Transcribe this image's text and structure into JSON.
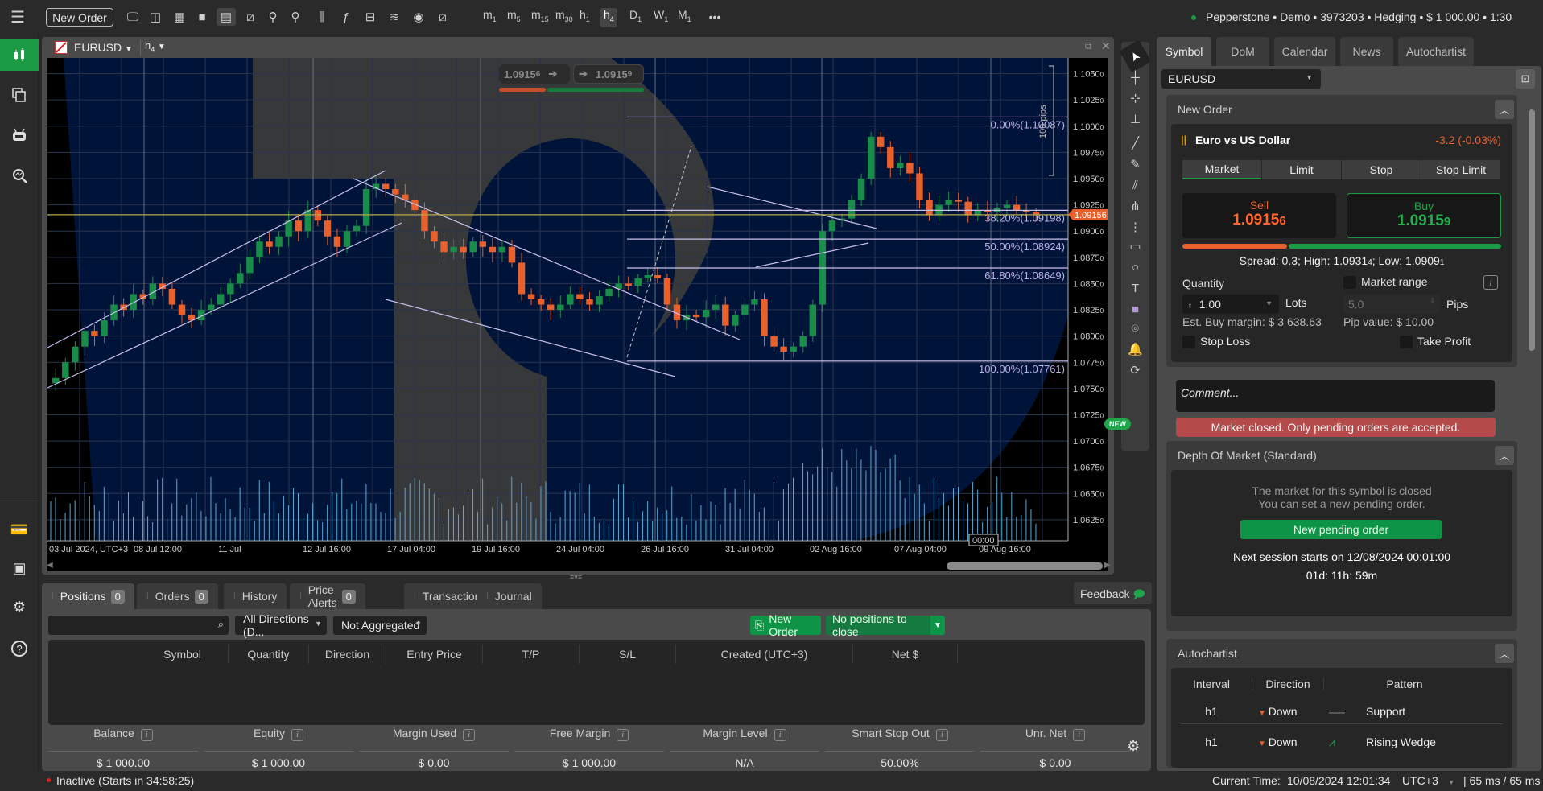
{
  "topbar": {
    "new_order_label": "New Order",
    "icons": [
      "chart-monitor-icon",
      "layout-split-icon",
      "grid-4-icon",
      "single-view-icon",
      "multi-view-icon",
      "chart-add-icon",
      "zoom-out-icon",
      "zoom-in-icon",
      "chart-type-icon",
      "indicators-icon",
      "robot-icon",
      "layers-icon",
      "eye-icon",
      "chart-settings-icon"
    ],
    "timeframes": [
      {
        "letter": "m",
        "sub": "1",
        "active": false
      },
      {
        "letter": "m",
        "sub": "5",
        "active": false
      },
      {
        "letter": "m",
        "sub": "15",
        "active": false
      },
      {
        "letter": "m",
        "sub": "30",
        "active": false
      },
      {
        "letter": "h",
        "sub": "1",
        "active": false
      },
      {
        "letter": "h",
        "sub": "4",
        "active": true
      },
      {
        "letter": "D",
        "sub": "1",
        "active": false
      },
      {
        "letter": "W",
        "sub": "1",
        "active": false
      },
      {
        "letter": "M",
        "sub": "1",
        "active": false
      }
    ],
    "more_label": "•••",
    "account": "Pepperstone • Demo • 3973203 • Hedging • $ 1 000.00 • 1:30",
    "account_status_color": "#1d9a3c"
  },
  "left_sidebar": {
    "items": [
      "trade-chart-icon",
      "copy-icon",
      "algo-robot-icon",
      "analyze-icon"
    ],
    "bottom_items": [
      "atm-icon",
      "wallet-icon",
      "settings-icon",
      "help-icon"
    ]
  },
  "chart": {
    "symbol": "EURUSD",
    "timeframe_letter": "h",
    "timeframe_sub": "4",
    "quick_sell": "1.0915",
    "quick_sell_pip": "6",
    "quick_buy": "1.0915",
    "quick_buy_pip": "9",
    "current_price_label": "1.09156",
    "new_badge": "NEW",
    "pips_label": "100 pips",
    "time_cursor_label": "00:00",
    "colors": {
      "bull": "#1a8c4a",
      "bear": "#e8612c",
      "bg": "#00143a",
      "accent_line": "#b8a84a",
      "fib": "#b9aee6"
    }
  },
  "chart_data": {
    "type": "candlestick",
    "title": "EURUSD h4",
    "ylim": [
      1.0605,
      1.1065
    ],
    "y_ticks": [
      "1.1050",
      "1.1025",
      "1.1000",
      "1.0975",
      "1.0950",
      "1.0925",
      "1.0900",
      "1.0875",
      "1.0850",
      "1.0825",
      "1.0800",
      "1.0775",
      "1.0750",
      "1.0725",
      "1.0700",
      "1.0675",
      "1.0650",
      "1.0625"
    ],
    "x_ticks": [
      "03 Jul 2024, UTC+3",
      "08 Jul 12:00",
      "11 Jul",
      "12 Jul 16:00",
      "17 Jul 04:00",
      "19 Jul 16:00",
      "24 Jul 04:00",
      "26 Jul 16:00",
      "31 Jul 04:00",
      "02 Aug 16:00",
      "07 Aug 04:00",
      "09 Aug 16:00"
    ],
    "current_price": 1.09156,
    "fib_levels": [
      {
        "label": "0.00%(1.10087)",
        "price": 1.10087
      },
      {
        "label": "38.20%(1.09198)",
        "price": 1.09198
      },
      {
        "label": "50.00%(1.08924)",
        "price": 1.08924
      },
      {
        "label": "61.80%(1.08649)",
        "price": 1.08649
      },
      {
        "label": "100.00%(1.07761)",
        "price": 1.07761
      }
    ],
    "price_path": [
      1.076,
      1.0775,
      1.079,
      1.0805,
      1.08,
      1.0815,
      1.083,
      1.0825,
      1.084,
      1.0835,
      1.085,
      1.0845,
      1.083,
      1.082,
      1.0815,
      1.0825,
      1.083,
      1.084,
      1.085,
      1.086,
      1.0875,
      1.089,
      1.0885,
      1.0895,
      1.091,
      1.09,
      1.092,
      1.091,
      1.0895,
      1.0885,
      1.09,
      1.0905,
      1.094,
      1.0945,
      1.094,
      1.0935,
      1.093,
      1.092,
      1.09,
      1.089,
      1.088,
      1.0885,
      1.088,
      1.089,
      1.0885,
      1.088,
      1.0885,
      1.087,
      1.084,
      1.0835,
      1.083,
      1.0825,
      1.083,
      1.084,
      1.0835,
      1.083,
      1.0838,
      1.0845,
      1.085,
      1.0848,
      1.0855,
      1.0858,
      1.0855,
      1.083,
      1.0815,
      1.082,
      1.0818,
      1.0825,
      1.083,
      1.081,
      1.082,
      1.083,
      1.0835,
      1.08,
      1.079,
      1.0785,
      1.079,
      1.08,
      1.083,
      1.09,
      1.091,
      1.0912,
      1.093,
      1.095,
      1.099,
      1.098,
      1.096,
      1.0965,
      1.0955,
      1.093,
      1.0915,
      1.0925,
      1.093,
      1.0928,
      1.0915,
      1.092,
      1.0918,
      1.0922,
      1.0925,
      1.092,
      1.0918,
      1.0916
    ]
  },
  "right_tools": [
    "cursor-icon",
    "crosshair-icon",
    "crosshair-snap-icon",
    "measure-icon",
    "trendline-icon",
    "pen-icon",
    "fibonacci-icon",
    "pitchfork-icon",
    "fib-grid-icon",
    "rectangle-icon",
    "ellipse-icon",
    "text-icon",
    "color-swatch-icon",
    "camera-icon",
    "alert-bell-icon",
    "replay-icon"
  ],
  "right_panel": {
    "tabs": [
      {
        "label": "Symbol",
        "active": true
      },
      {
        "label": "DoM",
        "active": false
      },
      {
        "label": "Calendar",
        "active": false
      },
      {
        "label": "News",
        "active": false
      },
      {
        "label": "Autochartist",
        "active": false
      }
    ],
    "symbol_select": "EURUSD",
    "new_order": {
      "title": "New Order",
      "symbol_name": "Euro vs US Dollar",
      "change": "-3.2 (-0.03%)",
      "order_types": [
        {
          "label": "Market",
          "active": true
        },
        {
          "label": "Limit",
          "active": false
        },
        {
          "label": "Stop",
          "active": false
        },
        {
          "label": "Stop Limit",
          "active": false
        }
      ],
      "sell_label": "Sell",
      "sell_price": "1.0915",
      "sell_pip": "6",
      "buy_label": "Buy",
      "buy_price": "1.0915",
      "buy_pip": "9",
      "sell_share": 0.33,
      "spread_text": "Spread: 0.3; High: 1.0931",
      "high_pip": "4",
      "low_text": "; Low: 1.0909",
      "low_pip": "1",
      "quantity_label": "Quantity",
      "quantity_value": "1.00",
      "lots_label": "Lots",
      "market_range_label": "Market range",
      "pips_value": "5.0",
      "pips_label": "Pips",
      "est_margin": "Est. Buy margin: $ 3 638.63",
      "pip_value": "Pip value: $ 10.00",
      "stop_loss_label": "Stop Loss",
      "take_profit_label": "Take Profit",
      "comment_placeholder": "Comment...",
      "market_closed": "Market closed. Only pending orders are accepted."
    },
    "dom": {
      "title": "Depth Of Market (Standard)",
      "msg1": "The market for this symbol is closed",
      "msg2": "You can set a new pending order.",
      "button": "New pending order",
      "next_session": "Next session starts on 12/08/2024 00:01:00",
      "countdown": "01d: 11h: 59m"
    },
    "autochartist": {
      "title": "Autochartist",
      "headers": [
        "Interval",
        "Direction",
        "Pattern"
      ],
      "rows": [
        {
          "interval": "h1",
          "direction": "Down",
          "pattern": "Support",
          "icon": "support-pattern-icon"
        },
        {
          "interval": "h1",
          "direction": "Down",
          "pattern": "Rising Wedge",
          "icon": "rising-wedge-pattern-icon"
        }
      ]
    }
  },
  "bottom_panel": {
    "tabs": [
      {
        "label": "Positions",
        "badge": "0",
        "active": true
      },
      {
        "label": "Orders",
        "badge": "0",
        "active": false
      },
      {
        "label": "History",
        "badge": null,
        "active": false
      },
      {
        "label": "Price Alerts",
        "badge": "0",
        "active": false
      },
      {
        "label": "Transactions",
        "badge": null,
        "active": false
      },
      {
        "label": "Journal",
        "badge": null,
        "active": false
      }
    ],
    "feedback_label": "Feedback",
    "search_placeholder": "",
    "direction_filter": "All Directions (D...",
    "aggregation_filter": "Not Aggregated",
    "new_order_label": "New Order",
    "close_label": "No positions to close",
    "columns": [
      "Symbol",
      "Quantity",
      "Direction",
      "Entry Price",
      "T/P",
      "S/L",
      "Created (UTC+3)",
      "Net $"
    ],
    "summary": [
      {
        "label": "Balance",
        "value": "$ 1 000.00"
      },
      {
        "label": "Equity",
        "value": "$ 1 000.00"
      },
      {
        "label": "Margin Used",
        "value": "$ 0.00"
      },
      {
        "label": "Free Margin",
        "value": "$ 1 000.00"
      },
      {
        "label": "Margin Level",
        "value": "N/A"
      },
      {
        "label": "Smart Stop Out",
        "value": "50.00%"
      },
      {
        "label": "Unr. Net",
        "value": "$ 0.00"
      }
    ]
  },
  "statusbar": {
    "status": "Inactive (Starts in 34:58:25)",
    "status_color": "#e02020",
    "current_time_label": "Current Time:",
    "current_time": "10/08/2024 12:01:34",
    "timezone": "UTC+3",
    "latency": "| 65 ms / 65 ms"
  }
}
